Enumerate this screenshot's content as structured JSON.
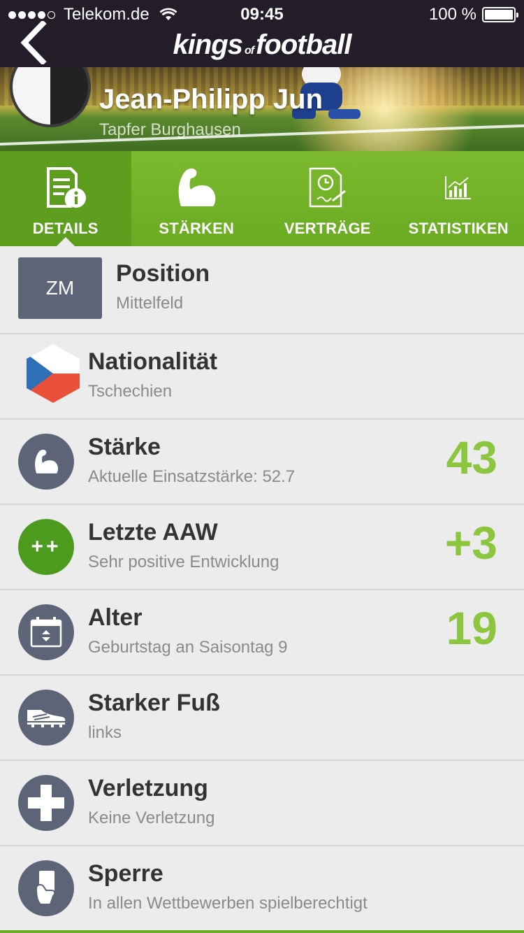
{
  "status": {
    "carrier": "Telekom.de",
    "time": "09:45",
    "battery": "100 %"
  },
  "nav": {
    "logo_left": "kings",
    "logo_mid": "of",
    "logo_right": "football",
    "back_icon": "chevron-left-icon"
  },
  "player": {
    "name": "Jean-Philipp Jun",
    "club": "Tapfer Burghausen"
  },
  "tabs": [
    {
      "label": "DETAILS",
      "icon": "details-icon",
      "active": true
    },
    {
      "label": "STÄRKEN",
      "icon": "bicep-icon",
      "active": false
    },
    {
      "label": "VERTRÄGE",
      "icon": "contract-icon",
      "active": false
    },
    {
      "label": "STATISTIKEN",
      "icon": "chart-icon",
      "active": false
    }
  ],
  "rows": [
    {
      "badge": "ZM",
      "title": "Position",
      "sub": "Mittelfeld"
    },
    {
      "icon": "czech-flag-icon",
      "title": "Nationalität",
      "sub": "Tschechien"
    },
    {
      "icon": "bicep-icon",
      "title": "Stärke",
      "sub": "Aktuelle Einsatzstärke: 52.7",
      "value": "43"
    },
    {
      "icon": "plus-plus-icon",
      "badge": "++",
      "title": "Letzte AAW",
      "sub": "Sehr positive Entwicklung",
      "value": "+3"
    },
    {
      "icon": "calendar-icon",
      "title": "Alter",
      "sub": "Geburtstag an Saisontag 9",
      "value": "19"
    },
    {
      "icon": "boot-icon",
      "title": "Starker Fuß",
      "sub": "links"
    },
    {
      "icon": "medical-cross-icon",
      "title": "Verletzung",
      "sub": "Keine Verletzung"
    },
    {
      "icon": "red-card-icon",
      "title": "Sperre",
      "sub": "In allen Wettbewerben spielberechtigt"
    }
  ],
  "colors": {
    "navbar": "#231c29",
    "accent_green": "#6aab23",
    "value_green": "#8cc63f",
    "icon_slate": "#5d6478"
  }
}
